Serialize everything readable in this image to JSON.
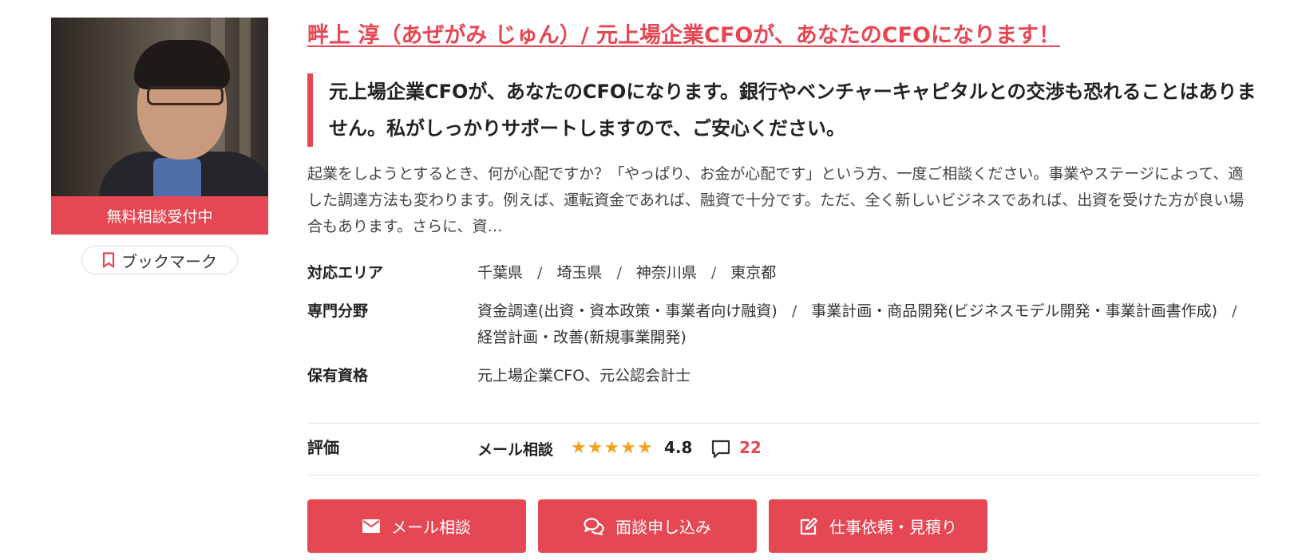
{
  "profile": {
    "consult_badge": "無料相談受付中",
    "bookmark_label": "ブックマーク"
  },
  "title": "畔上 淳（あぜがみ じゅん）/ 元上場企業CFOが、あなたのCFOになります！",
  "catchphrase": "元上場企業CFOが、あなたのCFOになります。銀行やベンチャーキャピタルとの交渉も恐れることはありません。私がしっかりサポートしますので、ご安心ください。",
  "description": "起業をしようとするとき、何が心配ですか？「やっぱり、お金が心配です」という方、一度ご相談ください。事業やステージによって、適した調達方法も変わります。例えば、運転資金であれば、融資で十分です。ただ、全く新しいビジネスであれば、出資を受けた方が良い場合もあります。さらに、資…",
  "info": {
    "area_label": "対応エリア",
    "areas": [
      "千葉県",
      "埼玉県",
      "神奈川県",
      "東京都"
    ],
    "field_label": "専門分野",
    "fields": [
      "資金調達(出資・資本政策・事業者向け融資)",
      "事業計画・商品開発(ビジネスモデル開発・事業計画書作成)",
      "経営計画・改善(新規事業開発)"
    ],
    "qualification_label": "保有資格",
    "qualifications": "元上場企業CFO、元公認会計士"
  },
  "evaluation": {
    "label": "評価",
    "type": "メール相談",
    "stars": 5,
    "rating": "4.8",
    "comment_count": "22"
  },
  "actions": {
    "mail": "メール相談",
    "meeting": "面談申し込み",
    "request": "仕事依頼・見積り"
  },
  "colors": {
    "accent": "#e54753",
    "star": "#f4a220"
  }
}
